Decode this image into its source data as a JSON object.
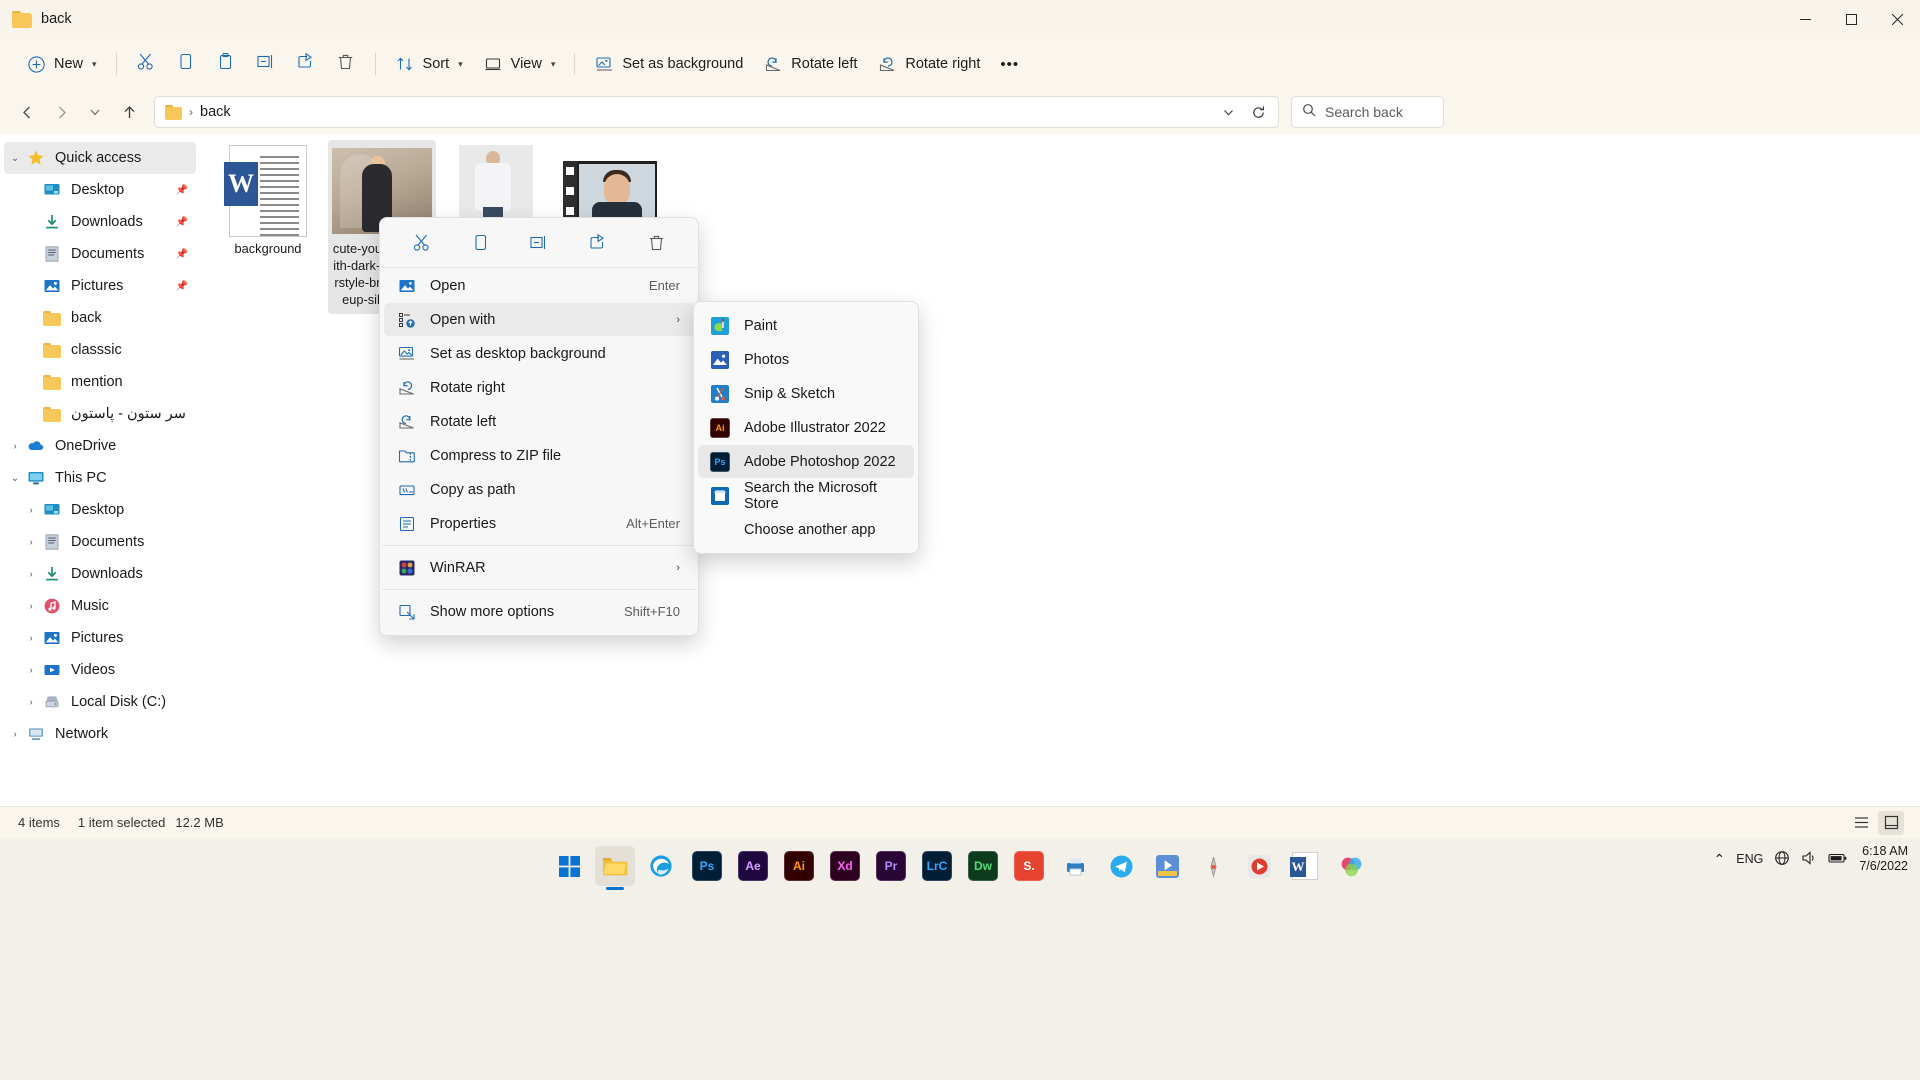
{
  "window": {
    "title": "back",
    "folder_icon": "folder-icon",
    "controls": {
      "minimize": "minimize-icon",
      "maximize": "maximize-icon",
      "close": "close-icon"
    }
  },
  "toolbar": {
    "new_label": "New",
    "cut_icon": "cut-icon",
    "copy_icon": "copy-icon",
    "paste_icon": "paste-icon",
    "rename_icon": "rename-icon",
    "share_icon": "share-icon",
    "delete_icon": "delete-icon",
    "sort_label": "Sort",
    "view_label": "View",
    "set_background_label": "Set as background",
    "rotate_left_label": "Rotate left",
    "rotate_right_label": "Rotate right",
    "more_label": "•••"
  },
  "address": {
    "crumb": "back",
    "separator": "›",
    "dropdown_icon": "chevron-down-icon",
    "refresh_icon": "refresh-icon"
  },
  "search": {
    "placeholder": "Search back",
    "icon": "search-icon"
  },
  "sidebar": {
    "items": [
      {
        "label": "Quick access",
        "icon": "star-icon",
        "twisty": "⌄",
        "indent": 0,
        "selected": true,
        "pinned": false
      },
      {
        "label": "Desktop",
        "icon": "desktop-icon",
        "twisty": "",
        "indent": 1,
        "selected": false,
        "pinned": true
      },
      {
        "label": "Downloads",
        "icon": "downloads-icon",
        "twisty": "",
        "indent": 1,
        "selected": false,
        "pinned": true
      },
      {
        "label": "Documents",
        "icon": "documents-icon",
        "twisty": "",
        "indent": 1,
        "selected": false,
        "pinned": true
      },
      {
        "label": "Pictures",
        "icon": "pictures-icon",
        "twisty": "",
        "indent": 1,
        "selected": false,
        "pinned": true
      },
      {
        "label": "back",
        "icon": "folder-icon",
        "twisty": "",
        "indent": 1,
        "selected": false,
        "pinned": false
      },
      {
        "label": "classsic",
        "icon": "folder-icon",
        "twisty": "",
        "indent": 1,
        "selected": false,
        "pinned": false
      },
      {
        "label": "mention",
        "icon": "folder-icon",
        "twisty": "",
        "indent": 1,
        "selected": false,
        "pinned": false
      },
      {
        "label": "سر ستون - پاستون -",
        "icon": "folder-icon",
        "twisty": "",
        "indent": 1,
        "selected": false,
        "pinned": false
      },
      {
        "label": "OneDrive",
        "icon": "onedrive-icon",
        "twisty": "›",
        "indent": 0,
        "selected": false,
        "pinned": false
      },
      {
        "label": "This PC",
        "icon": "thispc-icon",
        "twisty": "⌄",
        "indent": 0,
        "selected": false,
        "pinned": false
      },
      {
        "label": "Desktop",
        "icon": "desktop-icon",
        "twisty": "›",
        "indent": 1,
        "selected": false,
        "pinned": false
      },
      {
        "label": "Documents",
        "icon": "documents-icon",
        "twisty": "›",
        "indent": 1,
        "selected": false,
        "pinned": false
      },
      {
        "label": "Downloads",
        "icon": "downloads-icon",
        "twisty": "›",
        "indent": 1,
        "selected": false,
        "pinned": false
      },
      {
        "label": "Music",
        "icon": "music-icon",
        "twisty": "›",
        "indent": 1,
        "selected": false,
        "pinned": false
      },
      {
        "label": "Pictures",
        "icon": "pictures-icon",
        "twisty": "›",
        "indent": 1,
        "selected": false,
        "pinned": false
      },
      {
        "label": "Videos",
        "icon": "videos-icon",
        "twisty": "›",
        "indent": 1,
        "selected": false,
        "pinned": false
      },
      {
        "label": "Local Disk (C:)",
        "icon": "disk-icon",
        "twisty": "›",
        "indent": 1,
        "selected": false,
        "pinned": false
      },
      {
        "label": "Network",
        "icon": "network-icon",
        "twisty": "›",
        "indent": 0,
        "selected": false,
        "pinned": false
      }
    ]
  },
  "files": [
    {
      "name": "background",
      "type": "word-document",
      "selected": false
    },
    {
      "name": "cute-young-girl-with-dark-wavy-hairstyle-bright-makeup-silk-dress",
      "type": "image",
      "selected": true
    },
    {
      "name": "",
      "type": "image2",
      "selected": false
    },
    {
      "name": "",
      "type": "video",
      "selected": false
    }
  ],
  "context_menu": {
    "icon_row": [
      {
        "name": "cut-icon"
      },
      {
        "name": "copy-icon"
      },
      {
        "name": "rename-icon"
      },
      {
        "name": "share-icon"
      },
      {
        "name": "delete-icon"
      }
    ],
    "items": [
      {
        "label": "Open",
        "icon": "picture-icon",
        "accel": "Enter",
        "arrow": false,
        "highlighted": false
      },
      {
        "label": "Open with",
        "icon": "open-with-icon",
        "accel": "",
        "arrow": true,
        "highlighted": true
      },
      {
        "label": "Set as desktop background",
        "icon": "set-background-icon",
        "accel": "",
        "arrow": false,
        "highlighted": false
      },
      {
        "label": "Rotate right",
        "icon": "rotate-right-icon",
        "accel": "",
        "arrow": false,
        "highlighted": false
      },
      {
        "label": "Rotate left",
        "icon": "rotate-left-icon",
        "accel": "",
        "arrow": false,
        "highlighted": false
      },
      {
        "label": "Compress to ZIP file",
        "icon": "zip-icon",
        "accel": "",
        "arrow": false,
        "highlighted": false
      },
      {
        "label": "Copy as path",
        "icon": "copy-path-icon",
        "accel": "",
        "arrow": false,
        "highlighted": false
      },
      {
        "label": "Properties",
        "icon": "properties-icon",
        "accel": "Alt+Enter",
        "arrow": false,
        "highlighted": false
      }
    ],
    "items_after_divider": [
      {
        "label": "WinRAR",
        "icon": "winrar-icon",
        "accel": "",
        "arrow": true,
        "highlighted": false
      }
    ],
    "items_last": [
      {
        "label": "Show more options",
        "icon": "more-options-icon",
        "accel": "Shift+F10",
        "arrow": false,
        "highlighted": false
      }
    ]
  },
  "submenu": {
    "items": [
      {
        "label": "Paint",
        "icon": "paint-icon",
        "icon_text": "",
        "color": "#2b9ad6",
        "highlighted": false
      },
      {
        "label": "Photos",
        "icon": "photos-icon",
        "icon_text": "",
        "color": "#2d6fd0",
        "highlighted": false
      },
      {
        "label": "Snip & Sketch",
        "icon": "snip-sketch-icon",
        "icon_text": "",
        "color": "#2b7fc9",
        "highlighted": false
      },
      {
        "label": "Adobe Illustrator 2022",
        "icon": "illustrator-icon",
        "icon_text": "Ai",
        "color": "#330000",
        "highlighted": false
      },
      {
        "label": "Adobe Photoshop 2022",
        "icon": "photoshop-icon",
        "icon_text": "Ps",
        "color": "#001e36",
        "highlighted": true
      },
      {
        "label": "Search the Microsoft Store",
        "icon": "microsoft-store-icon",
        "icon_text": "",
        "color": "#0d6ab5",
        "highlighted": false
      },
      {
        "label": "Choose another app",
        "icon": "",
        "icon_text": "",
        "color": "",
        "highlighted": false
      }
    ]
  },
  "statusbar": {
    "item_count": "4 items",
    "selection": "1 item selected",
    "size": "12.2 MB",
    "list_view_icon": "list-view-icon",
    "detail_view_icon": "tile-view-icon"
  },
  "taskbar": {
    "apps": [
      {
        "name": "start-button",
        "label": "",
        "color": "#0a72d4",
        "active": false
      },
      {
        "name": "file-explorer",
        "label": "",
        "color": "#f7c75a",
        "active": true
      },
      {
        "name": "edge-browser",
        "label": "",
        "color": "#2a9fd6",
        "active": false
      },
      {
        "name": "photoshop",
        "label": "Ps",
        "color": "#001e36",
        "active": false
      },
      {
        "name": "after-effects",
        "label": "Ae",
        "color": "#1f0740",
        "active": false
      },
      {
        "name": "illustrator",
        "label": "Ai",
        "color": "#330000",
        "active": false
      },
      {
        "name": "adobe-xd",
        "label": "Xd",
        "color": "#2e001f",
        "active": false
      },
      {
        "name": "premiere-pro",
        "label": "Pr",
        "color": "#2a0634",
        "active": false
      },
      {
        "name": "lightroom-classic",
        "label": "LrC",
        "color": "#001e36",
        "active": false
      },
      {
        "name": "dreamweaver",
        "label": "Dw",
        "color": "#0c3b1e",
        "active": false
      },
      {
        "name": "sketchup",
        "label": "S.",
        "color": "#e8432e",
        "active": false
      },
      {
        "name": "printer-app",
        "label": "",
        "color": "#1f7ec2",
        "active": false
      },
      {
        "name": "telegram",
        "label": "",
        "color": "#2aabee",
        "active": false
      },
      {
        "name": "media-player",
        "label": "",
        "color": "#5b8fd6",
        "active": false
      },
      {
        "name": "audio-app",
        "label": "",
        "color": "#c8c8c8",
        "active": false
      },
      {
        "name": "video-player",
        "label": "",
        "color": "#e03b2f",
        "active": false
      },
      {
        "name": "word",
        "label": "W",
        "color": "#2b5797",
        "active": false
      },
      {
        "name": "paint-3d",
        "label": "",
        "color": "#9b59b6",
        "active": false
      }
    ],
    "tray": {
      "chevron": "⌃",
      "language": "ENG",
      "network_icon": "network-icon",
      "volume_icon": "volume-icon",
      "battery_icon": "battery-icon",
      "time": "6:18 AM",
      "date": "7/6/2022"
    }
  }
}
